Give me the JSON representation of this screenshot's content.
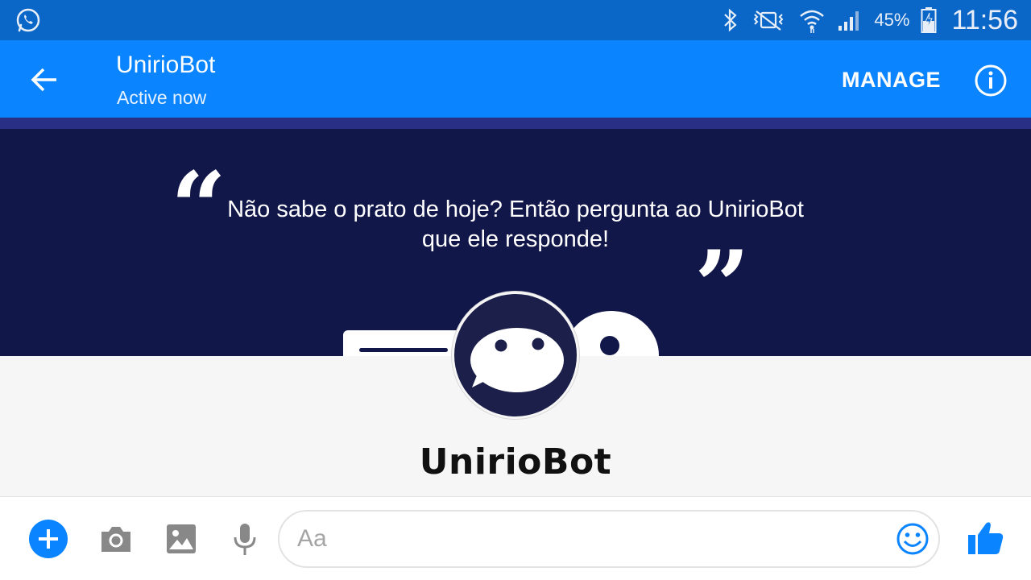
{
  "status_bar": {
    "battery_percent": "45%",
    "time": "11:56",
    "icons": [
      "whatsapp-icon",
      "bluetooth-icon",
      "vibrate-mute-icon",
      "wifi-icon",
      "signal-icon",
      "battery-charging-icon"
    ]
  },
  "header": {
    "title": "UnirioBot",
    "subtitle": "Active now",
    "manage_label": "MANAGE",
    "icons": [
      "back-arrow-icon",
      "info-icon"
    ]
  },
  "cover": {
    "quote_open": "“",
    "quote_close": "”",
    "text": "Não sabe o prato de hoje? Então pergunta ao UnirioBot que ele responde!"
  },
  "profile": {
    "name": "UnirioBot"
  },
  "composer": {
    "placeholder": "Aa",
    "icons": [
      "plus-icon",
      "camera-icon",
      "image-icon",
      "microphone-icon",
      "emoji-icon",
      "thumbs-up-icon"
    ]
  },
  "colors": {
    "status_bar": "#0a67c8",
    "header": "#0b84ff",
    "cover_bg": "#12174a",
    "avatar_bg": "#1b1f49",
    "accent": "#0b84ff"
  }
}
